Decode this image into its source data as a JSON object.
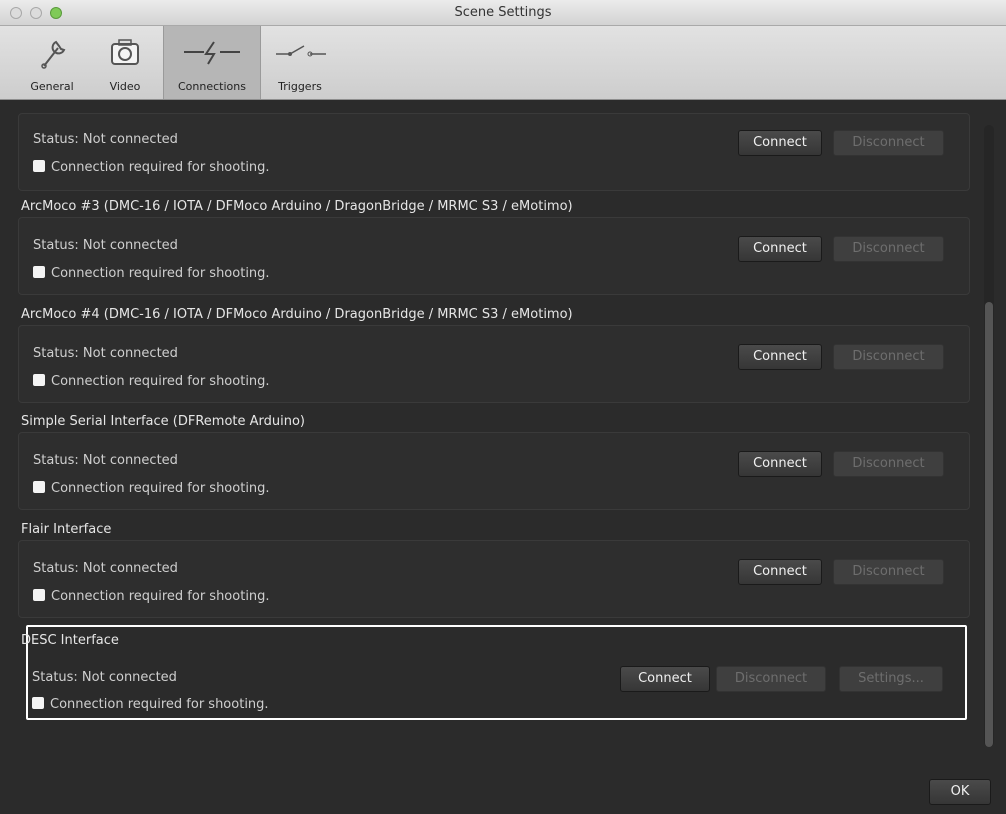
{
  "window": {
    "title": "Scene Settings"
  },
  "toolbar": {
    "tabs": [
      {
        "label": "General",
        "icon": "wrench-icon"
      },
      {
        "label": "Video",
        "icon": "camera-icon"
      },
      {
        "label": "Connections",
        "icon": "lightning-icon",
        "selected": true
      },
      {
        "label": "Triggers",
        "icon": "switch-icon"
      }
    ]
  },
  "connections": {
    "groups": [
      {
        "title": "",
        "status": "Status: Not connected",
        "checkbox_label": "Connection required for shooting.",
        "connect": "Connect",
        "disconnect": "Disconnect"
      },
      {
        "title": "ArcMoco #3 (DMC-16 / IOTA / DFMoco Arduino / DragonBridge / MRMC S3 / eMotimo)",
        "status": "Status: Not connected",
        "checkbox_label": "Connection required for shooting.",
        "connect": "Connect",
        "disconnect": "Disconnect"
      },
      {
        "title": "ArcMoco #4 (DMC-16 / IOTA / DFMoco Arduino / DragonBridge / MRMC S3 / eMotimo)",
        "status": "Status: Not connected",
        "checkbox_label": "Connection required for shooting.",
        "connect": "Connect",
        "disconnect": "Disconnect"
      },
      {
        "title": "Simple Serial Interface (DFRemote Arduino)",
        "status": "Status: Not connected",
        "checkbox_label": "Connection required for shooting.",
        "connect": "Connect",
        "disconnect": "Disconnect"
      },
      {
        "title": "Flair Interface",
        "status": "Status: Not connected",
        "checkbox_label": "Connection required for shooting.",
        "connect": "Connect",
        "disconnect": "Disconnect"
      },
      {
        "title": "DESC Interface",
        "status": "Status: Not connected",
        "checkbox_label": "Connection required for shooting.",
        "connect": "Connect",
        "disconnect": "Disconnect",
        "settings": "Settings..."
      }
    ]
  },
  "footer": {
    "ok_label": "OK"
  },
  "colors": {
    "background": "#2b2b2b",
    "text": "#cfcfcf",
    "highlight": "#ffffff"
  }
}
